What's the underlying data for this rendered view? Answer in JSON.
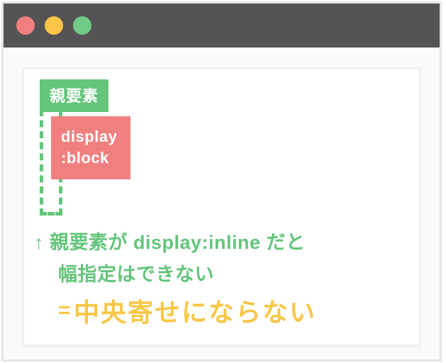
{
  "colors": {
    "titlebar": "#555356",
    "dot_red": "#f08080",
    "dot_yellow": "#fbc549",
    "dot_green": "#6fcb85",
    "accent_green": "#64c57b",
    "accent_yellow": "#f9c646",
    "block_red": "#f08080"
  },
  "parent_label": "親要素",
  "child_block": {
    "line1": "display",
    "line2": ":block"
  },
  "note": {
    "arrow": "↑",
    "line1_rest": "親要素が display:inline だと",
    "line2": "幅指定はできない",
    "equals": "=",
    "emphasis": "中央寄せにならない"
  }
}
